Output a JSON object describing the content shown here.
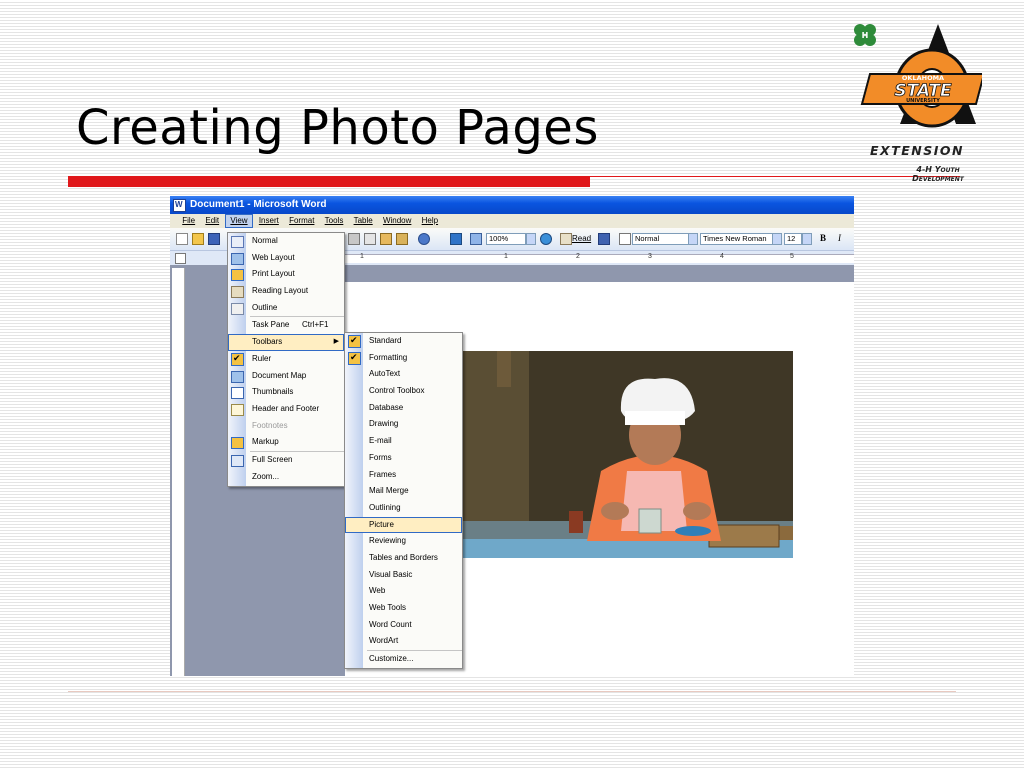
{
  "slide": {
    "title": "Creating Photo Pages"
  },
  "logo": {
    "university_top": "OKLAHOMA",
    "university_main": "STATE",
    "university_sub": "UNIVERSITY",
    "extension": "EXTENSION",
    "youth_line1": "4-H Youth",
    "youth_line2": "Development"
  },
  "word": {
    "window_title": "Document1 - Microsoft Word",
    "menubar": [
      "File",
      "Edit",
      "View",
      "Insert",
      "Format",
      "Tools",
      "Table",
      "Window",
      "Help"
    ],
    "zoom": "100%",
    "read_label": "Read",
    "style": "Normal",
    "font": "Times New Roman",
    "font_size": "12",
    "bold_label": "B",
    "italic_label": "I",
    "ruler_numbers": [
      "1",
      "1",
      "2",
      "3",
      "4",
      "5"
    ],
    "view_menu": {
      "items": [
        {
          "label": "Normal",
          "icon": "normal-view-icon"
        },
        {
          "label": "Web Layout",
          "icon": "web-layout-icon"
        },
        {
          "label": "Print Layout",
          "icon": "print-layout-icon",
          "active": true
        },
        {
          "label": "Reading Layout",
          "icon": "reading-layout-icon"
        },
        {
          "label": "Outline",
          "icon": "outline-view-icon"
        },
        {
          "label": "Task Pane",
          "shortcut": "Ctrl+F1"
        },
        {
          "label": "Toolbars",
          "submenu": true,
          "highlighted": true
        },
        {
          "label": "Ruler",
          "checked": true
        },
        {
          "label": "Document Map",
          "icon": "document-map-icon"
        },
        {
          "label": "Thumbnails",
          "icon": "thumbnails-icon"
        },
        {
          "label": "Header and Footer",
          "icon": "header-footer-icon"
        },
        {
          "label": "Footnotes",
          "disabled": true
        },
        {
          "label": "Markup",
          "icon": "markup-icon"
        },
        {
          "label": "Full Screen",
          "icon": "full-screen-icon"
        },
        {
          "label": "Zoom..."
        }
      ]
    },
    "toolbars_menu": {
      "items": [
        {
          "label": "Standard",
          "checked": true
        },
        {
          "label": "Formatting",
          "checked": true
        },
        {
          "label": "AutoText"
        },
        {
          "label": "Control Toolbox"
        },
        {
          "label": "Database"
        },
        {
          "label": "Drawing"
        },
        {
          "label": "E-mail"
        },
        {
          "label": "Forms"
        },
        {
          "label": "Frames"
        },
        {
          "label": "Mail Merge"
        },
        {
          "label": "Outlining"
        },
        {
          "label": "Picture",
          "highlighted": true
        },
        {
          "label": "Reviewing"
        },
        {
          "label": "Tables and Borders"
        },
        {
          "label": "Visual Basic"
        },
        {
          "label": "Web"
        },
        {
          "label": "Web Tools"
        },
        {
          "label": "Word Count"
        },
        {
          "label": "WordArt"
        },
        {
          "label": "Customize..."
        }
      ]
    }
  },
  "colors": {
    "accent_red": "#e0181b",
    "osu_orange": "#f28c28",
    "word_blue": "#0a55e0"
  }
}
